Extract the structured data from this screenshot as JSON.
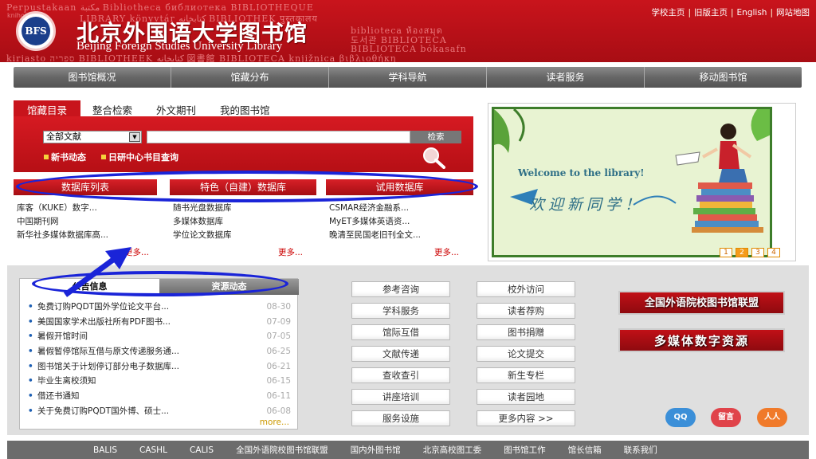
{
  "header": {
    "bg_rows": [
      "Perpustakaan  مكتبة  Bibliotheca  библиотека  BIBLIOTHEQUE",
      "LIBRARY  könyvtár  کتابخانه  BIBLIOTHEK  पुस्तकालय",
      "biblioteca  ห้องสมุด",
      "도서관  BIBLIOTECA",
      "BIBLIOTECA  bókasafn",
      "kirjasto  ספריה  BIBLIOTHEEK  کتابخانه  図書館  BIBLIOTECA knjižnica  βιβλιοθήκη"
    ],
    "side_letters": "knihovna",
    "logo_text": "BFS",
    "title_cn": "北京外国语大学图书馆",
    "title_en": "Beijing Foreign Studies University Library",
    "top_links": [
      "学校主页",
      "旧版主页",
      "English",
      "网站地图"
    ],
    "top_link_sep": "|"
  },
  "nav": [
    "图书馆概况",
    "馆藏分布",
    "学科导航",
    "读者服务",
    "移动图书馆"
  ],
  "search": {
    "tabs": [
      "馆藏目录",
      "整合检索",
      "外文期刊",
      "我的图书馆"
    ],
    "scope": "全部文献",
    "query": "",
    "button": "检索",
    "quick_links": [
      "新书动态",
      "日研中心书目查询"
    ]
  },
  "databases": {
    "buttons": [
      "数据库列表",
      "特色（自建）数据库",
      "试用数据库"
    ],
    "col1": [
      "库客（KUKE）数字...",
      "中国期刊网",
      "新华社多媒体数据库高..."
    ],
    "col2": [
      "随书光盘数据库",
      "多媒体数据库",
      "学位论文数据库"
    ],
    "col3": [
      "CSMAR经济金融系...",
      "MyET多媒体英语资...",
      "晚清至民国老旧刊全文..."
    ],
    "more": [
      "更多...",
      "更多...",
      "更多..."
    ]
  },
  "banner": {
    "welcome_en": "Welcome to the library!",
    "welcome_cn": "欢迎新同学！",
    "pages": [
      "1",
      "2",
      "3",
      "4"
    ],
    "active_page": 2
  },
  "notices": {
    "tabs": [
      "公告信息",
      "资源动态"
    ],
    "items": [
      {
        "title": "免费订购PQDT国外学位论文平台...",
        "date": "08-30"
      },
      {
        "title": "美国国家学术出版社所有PDF图书...",
        "date": "07-09"
      },
      {
        "title": "暑假开馆时间",
        "date": "07-05"
      },
      {
        "title": "暑假暂停馆际互借与原文传递服务通...",
        "date": "06-25"
      },
      {
        "title": "图书馆关于计划停订部分电子数据库...",
        "date": "06-21"
      },
      {
        "title": "毕业生离校须知",
        "date": "06-15"
      },
      {
        "title": "借还书通知",
        "date": "06-11"
      },
      {
        "title": "关于免费订购PQDT国外博、硕士...",
        "date": "06-08"
      }
    ],
    "more": "more..."
  },
  "services": {
    "col1": [
      "参考咨询",
      "学科服务",
      "馆际互借",
      "文献传递",
      "查收查引",
      "讲座培训",
      "服务设施"
    ],
    "col2": [
      "校外访问",
      "读者荐购",
      "图书捐赠",
      "论文提交",
      "新生专栏",
      "读者园地",
      "更多内容 >>"
    ]
  },
  "promos": [
    "全国外语院校图书馆联盟",
    "多媒体数字资源"
  ],
  "social": [
    "QQ",
    "留言",
    "人人"
  ],
  "footer": [
    "BALIS",
    "CASHL",
    "CALIS",
    "全国外语院校图书馆联盟",
    "国内外图书馆",
    "北京高校图工委",
    "图书馆工作",
    "馆长信箱",
    "联系我们"
  ]
}
